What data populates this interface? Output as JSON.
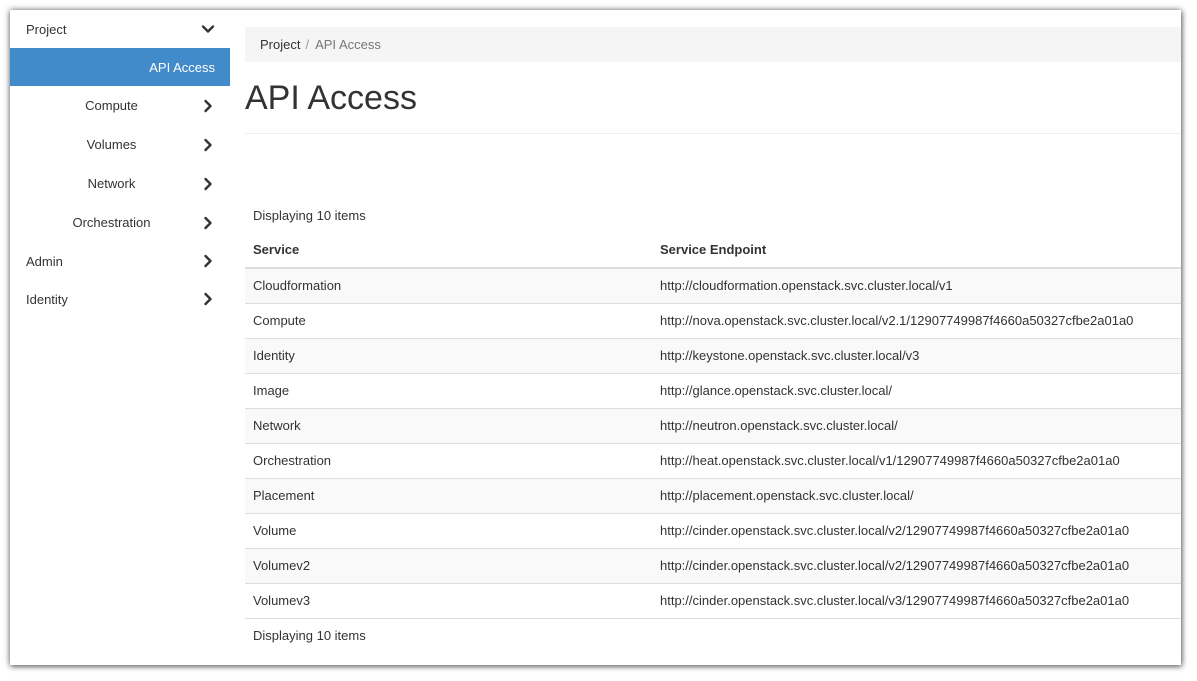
{
  "sidebar": {
    "project": {
      "label": "Project"
    },
    "active_item": {
      "label": "API Access"
    },
    "sub_items": [
      {
        "label": "Compute"
      },
      {
        "label": "Volumes"
      },
      {
        "label": "Network"
      },
      {
        "label": "Orchestration"
      }
    ],
    "top_items": [
      {
        "label": "Admin"
      },
      {
        "label": "Identity"
      }
    ],
    "accent_color": "#428bca"
  },
  "breadcrumb": {
    "items": [
      "Project",
      "API Access"
    ],
    "separator": "/"
  },
  "page": {
    "title": "API Access",
    "count_text": "Displaying 10 items"
  },
  "table": {
    "headers": [
      "Service",
      "Service Endpoint"
    ],
    "rows": [
      [
        "Cloudformation",
        "http://cloudformation.openstack.svc.cluster.local/v1"
      ],
      [
        "Compute",
        "http://nova.openstack.svc.cluster.local/v2.1/12907749987f4660a50327cfbe2a01a0"
      ],
      [
        "Identity",
        "http://keystone.openstack.svc.cluster.local/v3"
      ],
      [
        "Image",
        "http://glance.openstack.svc.cluster.local/"
      ],
      [
        "Network",
        "http://neutron.openstack.svc.cluster.local/"
      ],
      [
        "Orchestration",
        "http://heat.openstack.svc.cluster.local/v1/12907749987f4660a50327cfbe2a01a0"
      ],
      [
        "Placement",
        "http://placement.openstack.svc.cluster.local/"
      ],
      [
        "Volume",
        "http://cinder.openstack.svc.cluster.local/v2/12907749987f4660a50327cfbe2a01a0"
      ],
      [
        "Volumev2",
        "http://cinder.openstack.svc.cluster.local/v2/12907749987f4660a50327cfbe2a01a0"
      ],
      [
        "Volumev3",
        "http://cinder.openstack.svc.cluster.local/v3/12907749987f4660a50327cfbe2a01a0"
      ]
    ]
  }
}
